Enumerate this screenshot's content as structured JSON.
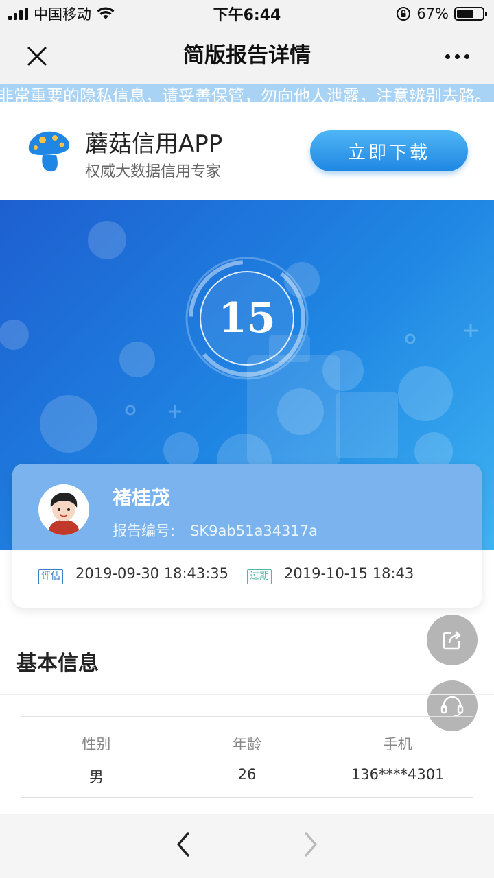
{
  "status_bar": {
    "carrier": "中国移动",
    "time": "下午6:44",
    "battery_percent": "67%",
    "battery_level": 0.67
  },
  "nav": {
    "title": "简版报告详情"
  },
  "marquee": {
    "text": "非常重要的隐私信息，请妥善保管，勿向他人泄露，注意辨别去路。"
  },
  "app_banner": {
    "name": "蘑菇信用APP",
    "slogan": "权威大数据信用专家",
    "download_label": "立即下载"
  },
  "score": {
    "value": "15"
  },
  "user": {
    "name": "褚桂茂",
    "report_no_label": "报告编号:",
    "report_no": "SK9ab51a34317a"
  },
  "dates": {
    "eval_tag": "评估",
    "eval_date": "2019-09-30 18:43:35",
    "expire_tag": "过期",
    "expire_date": "2019-10-15 18:43"
  },
  "basic_info": {
    "title": "基本信息",
    "cells": [
      {
        "label": "性别",
        "value": "男"
      },
      {
        "label": "年龄",
        "value": "26"
      },
      {
        "label": "手机",
        "value": "136****4301"
      }
    ]
  },
  "colors": {
    "accent": "#1f86e3",
    "hero_start": "#1e5fd0",
    "hero_end": "#3fb3f2"
  }
}
